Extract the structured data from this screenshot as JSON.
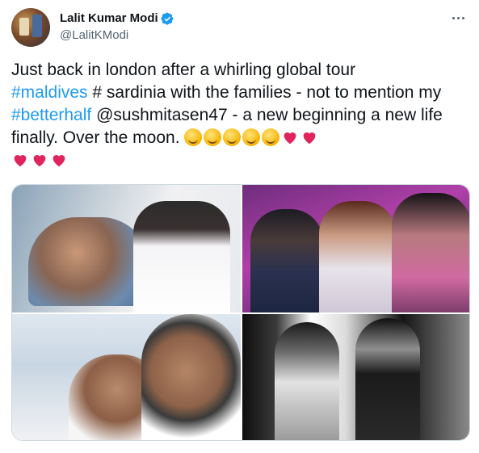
{
  "author": {
    "display_name": "Lalit Kumar Modi",
    "handle": "@LalitKModi",
    "verified": true
  },
  "tweet": {
    "line1": "Just back in london after a whirling global tour",
    "hashtag_maldives": "#maldives",
    "text_2": " # sardinia with the families - not to mention my ",
    "hashtag_betterhalf": "#betterhalf",
    "mention_sushmita": " @sushmitasen47",
    "text_3": " - a new beginning a new life finally. Over the moon.",
    "emojis": [
      "smiling-face-with-hearts",
      "face-blowing-kiss",
      "smiling-face-with-heart-eyes",
      "smiling-face-with-heart-eyes",
      "smiling-face-with-hearts",
      "two-hearts",
      "revolving-hearts",
      "sparkling-heart",
      "heart-with-arrow",
      "heart-with-ribbon"
    ]
  },
  "media": {
    "photos": [
      "photo-couple-resting",
      "photo-event-conversation",
      "photo-selfie-sunglasses",
      "photo-black-and-white"
    ]
  },
  "colors": {
    "link": "#1d9bf0",
    "text": "#0f1419",
    "secondary": "#536471",
    "verified": "#1d9bf0",
    "heart": "#e0245e"
  },
  "icons": {
    "verified": "verified-badge-icon",
    "more": "more-options-icon"
  }
}
